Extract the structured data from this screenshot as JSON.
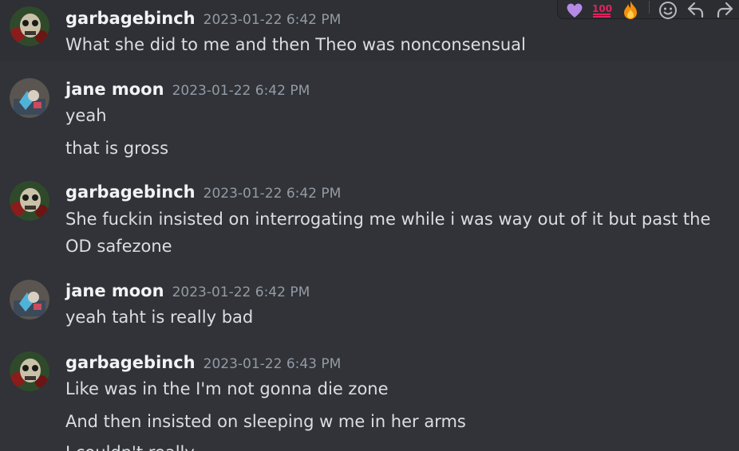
{
  "messages": [
    {
      "username": "garbagebinch",
      "timestamp": "2023-01-22 6:42 PM",
      "lines": [
        "What she did to me and then Theo was nonconsensual"
      ]
    },
    {
      "username": "jane moon",
      "timestamp": "2023-01-22 6:42 PM",
      "lines": [
        "yeah",
        "that is gross"
      ]
    },
    {
      "username": "garbagebinch",
      "timestamp": "2023-01-22 6:42 PM",
      "lines": [
        "She fuckin insisted on interrogating me while i was way out of it but past the",
        "OD safezone"
      ]
    },
    {
      "username": "jane moon",
      "timestamp": "2023-01-22 6:42 PM",
      "lines": [
        "yeah taht is really bad"
      ]
    },
    {
      "username": "garbagebinch",
      "timestamp": "2023-01-22 6:43 PM",
      "lines": [
        "Like was in the I'm not gonna die zone",
        "And then insisted on sleeping w me in her arms",
        "I couldn't really"
      ]
    }
  ],
  "toolbar": {
    "icons": [
      "purple-heart-icon",
      "hundred-points-icon",
      "fire-icon",
      "add-reaction-icon",
      "reply-icon",
      "forward-icon"
    ]
  },
  "colors": {
    "background": "#313338",
    "hover_background": "#2e3035",
    "username": "#f2f3f5",
    "timestamp": "#949ba4",
    "message_text": "#dbdee1"
  }
}
